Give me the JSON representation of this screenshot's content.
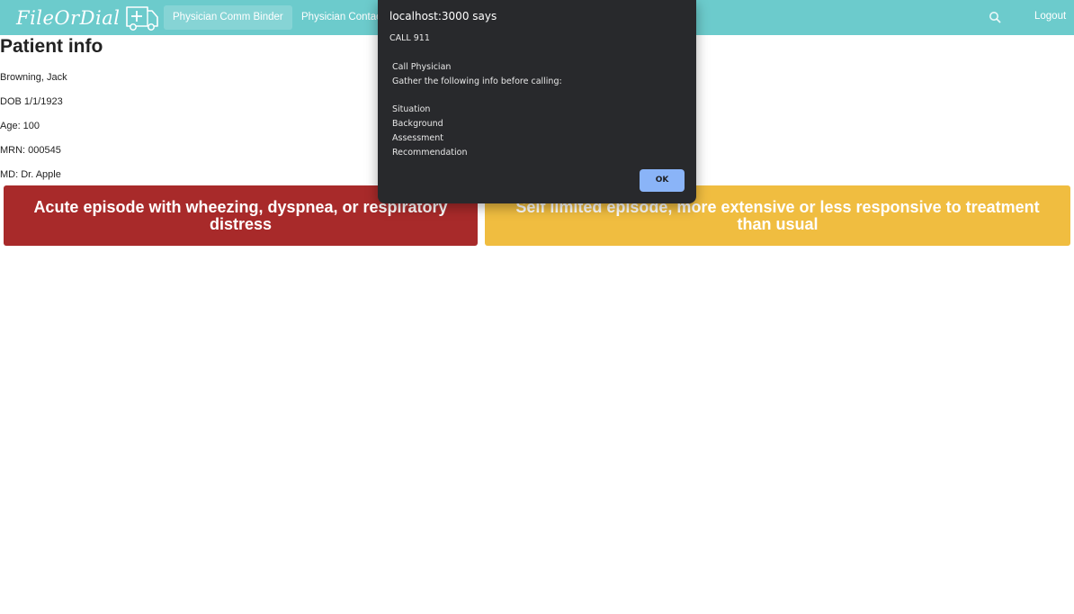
{
  "navbar": {
    "brand": "FileOrDial",
    "brand_icon": "ambulance-icon",
    "links": [
      {
        "label": "Physician Comm Binder",
        "active": true
      },
      {
        "label": "Physician Contacts",
        "active": false
      }
    ],
    "search_icon": "search-icon",
    "logout_label": "Logout",
    "background_color": "#6ccbcc"
  },
  "patient": {
    "title": "Patient info",
    "name": "Browning, Jack",
    "dob": "DOB 1/1/1923",
    "age": "Age: 100",
    "mrn": "MRN: 000545",
    "md": "MD: Dr. Apple"
  },
  "actions": [
    {
      "label": "Acute episode with wheezing, dyspnea, or respiratory distress",
      "color": "#a82a2a"
    },
    {
      "label": "Self limited episode, more extensive or less responsive to treatment than usual",
      "color": "#f0bd40"
    }
  ],
  "dialog": {
    "title": "localhost:3000 says",
    "message_lines": [
      "CALL 911",
      "",
      " Call Physician",
      " Gather the following info before calling:",
      "",
      " Situation",
      " Background",
      " Assessment",
      " Recommendation"
    ],
    "ok_label": "OK",
    "ok_color": "#8ab4f8"
  }
}
